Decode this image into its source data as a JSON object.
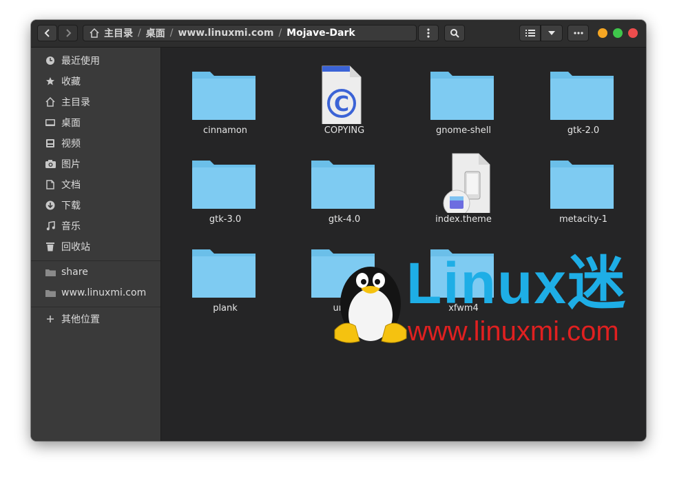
{
  "window": {
    "path": [
      "主目录",
      "桌面",
      "www.linuxmi.com",
      "Mojave-Dark"
    ],
    "home_icon": "home-icon",
    "controls": {
      "minimize_color": "#f5a623",
      "maximize_color": "#3fc64b",
      "close_color": "#ec4d4d"
    }
  },
  "toolbar": {
    "back_icon": "chevron-left-icon",
    "forward_icon": "chevron-right-icon",
    "menu_icon": "vertical-dots-icon",
    "search_icon": "search-icon",
    "view_icon": "list-view-icon",
    "view_options_icon": "chevron-down-icon",
    "more_icon": "horizontal-dots-icon"
  },
  "sidebar": {
    "places": [
      {
        "label": "最近使用",
        "icon": "clock-icon"
      },
      {
        "label": "收藏",
        "icon": "star-icon"
      },
      {
        "label": "主目录",
        "icon": "home-icon"
      },
      {
        "label": "桌面",
        "icon": "desktop-icon"
      },
      {
        "label": "视频",
        "icon": "video-icon"
      },
      {
        "label": "图片",
        "icon": "camera-icon"
      },
      {
        "label": "文档",
        "icon": "document-icon"
      },
      {
        "label": "下载",
        "icon": "download-icon"
      },
      {
        "label": "音乐",
        "icon": "music-icon"
      },
      {
        "label": "回收站",
        "icon": "trash-icon"
      }
    ],
    "bookmarks": [
      {
        "label": "share",
        "icon": "folder-icon"
      },
      {
        "label": "www.linuxmi.com",
        "icon": "folder-icon"
      }
    ],
    "other": {
      "label": "其他位置",
      "icon": "plus-icon"
    }
  },
  "files": [
    {
      "name": "cinnamon",
      "type": "folder"
    },
    {
      "name": "COPYING",
      "type": "license"
    },
    {
      "name": "gnome-shell",
      "type": "folder"
    },
    {
      "name": "gtk-2.0",
      "type": "folder"
    },
    {
      "name": "gtk-3.0",
      "type": "folder"
    },
    {
      "name": "gtk-4.0",
      "type": "folder"
    },
    {
      "name": "index.theme",
      "type": "theme"
    },
    {
      "name": "metacity-1",
      "type": "folder"
    },
    {
      "name": "plank",
      "type": "folder"
    },
    {
      "name": "unity",
      "type": "folder"
    },
    {
      "name": "xfwm4",
      "type": "folder"
    }
  ],
  "watermark": {
    "brand": "Linux迷",
    "url": "www.linuxmi.com",
    "brand_color": "#1eaee6",
    "url_color": "#e02020"
  },
  "colors": {
    "folder": "#7ecbf2",
    "folder_tab": "#6bbfe9",
    "sidebar_bg": "#3a3a3a",
    "content_bg": "#252526"
  }
}
